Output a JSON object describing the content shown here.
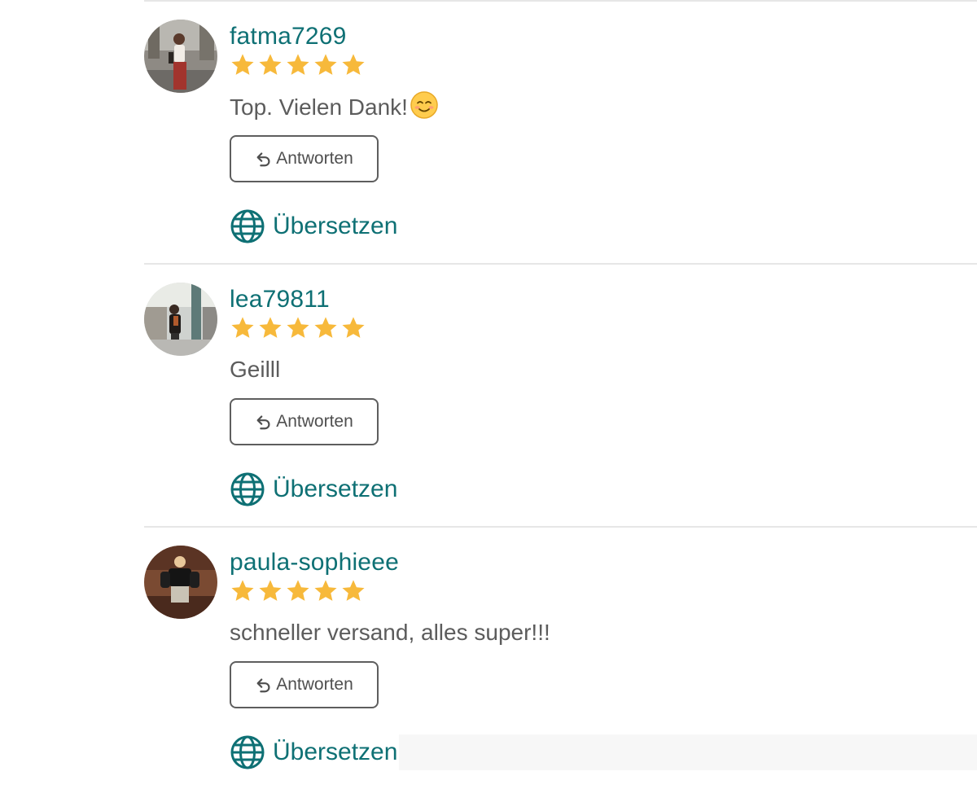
{
  "reviews": [
    {
      "username": "fatma7269",
      "rating": 5,
      "rating_max": 5,
      "comment": "Top. Vielen Dank!",
      "comment_emoji": "smiling-face-emoji",
      "reply_label": "Antworten",
      "translate_label": "Übersetzen"
    },
    {
      "username": "lea79811",
      "rating": 5,
      "rating_max": 5,
      "comment": "Geilll",
      "reply_label": "Antworten",
      "translate_label": "Übersetzen"
    },
    {
      "username": "paula-sophieee",
      "rating": 5,
      "rating_max": 5,
      "comment": "schneller versand, alles super!!!",
      "reply_label": "Antworten",
      "translate_label": "Übersetzen"
    }
  ],
  "icons": {
    "star": "star-icon",
    "reply": "reply-arrow-icon",
    "translate": "globe-icon"
  },
  "colors": {
    "accent": "#0e7074",
    "star": "#f7b93b",
    "text": "#5c5c5c",
    "border": "#5e5e5e",
    "divider": "#e6e6e6"
  }
}
